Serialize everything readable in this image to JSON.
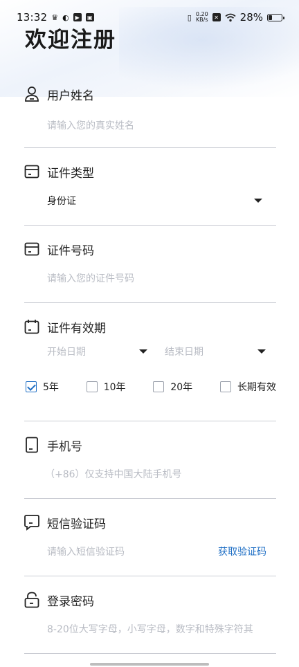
{
  "status_bar": {
    "time": "13:32",
    "speed_top": "0.20",
    "speed_bottom": "KB/s",
    "battery": "28%",
    "battery_level": 0.28
  },
  "page": {
    "title": "欢迎注册"
  },
  "form": {
    "name": {
      "label": "用户姓名",
      "placeholder": "请输入您的真实姓名",
      "icon": "user-icon"
    },
    "id_type": {
      "label": "证件类型",
      "value": "身份证",
      "icon": "id-card-icon"
    },
    "id_number": {
      "label": "证件号码",
      "placeholder": "请输入您的证件号码",
      "icon": "id-card-icon"
    },
    "validity": {
      "label": "证件有效期",
      "icon": "calendar-icon",
      "start_placeholder": "开始日期",
      "end_placeholder": "结束日期",
      "options": [
        {
          "label": "5年",
          "checked": true
        },
        {
          "label": "10年",
          "checked": false
        },
        {
          "label": "20年",
          "checked": false
        },
        {
          "label": "长期有效",
          "checked": false
        }
      ]
    },
    "phone": {
      "label": "手机号",
      "placeholder": "（+86）仅支持中国大陆手机号",
      "icon": "phone-icon"
    },
    "sms": {
      "label": "短信验证码",
      "placeholder": "请输入短信验证码",
      "action": "获取验证码",
      "icon": "message-icon"
    },
    "password": {
      "label": "登录密码",
      "placeholder": "8-20位大写字母，小写字母，数字和特殊字符其",
      "icon": "lock-icon"
    }
  },
  "colors": {
    "accent": "#1f6fc5",
    "divider": "#c9cbd3",
    "placeholder": "#b9bcc4"
  }
}
